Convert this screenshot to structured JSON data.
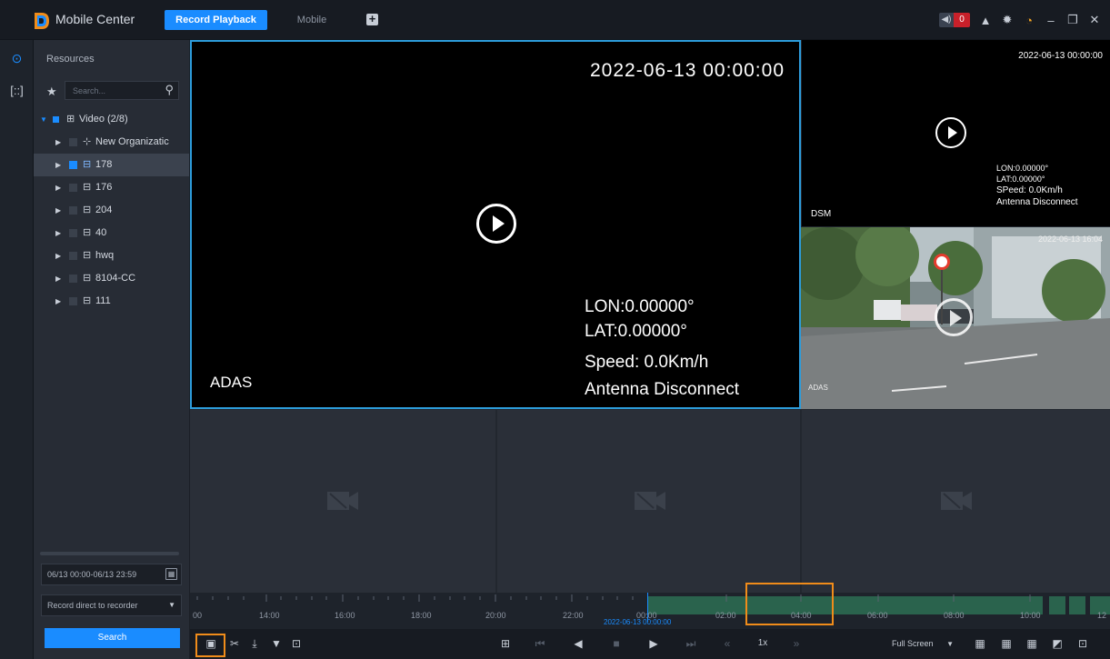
{
  "app": {
    "title": "Mobile Center"
  },
  "tabs": [
    {
      "label": "Record Playback",
      "active": true
    },
    {
      "label": "Mobile",
      "active": false
    }
  ],
  "alarm": {
    "count": "0"
  },
  "panel": {
    "title": "Resources",
    "search_placeholder": "Search...",
    "tree": [
      {
        "label": "Video (2/8)",
        "level": 0,
        "expanded": true,
        "check": "partial",
        "icon": "device-group-icon"
      },
      {
        "label": "New Organizatic",
        "level": 1,
        "check": "none",
        "icon": "organization-icon"
      },
      {
        "label": "178",
        "level": 1,
        "check": "checked",
        "icon": "vehicle-online-icon",
        "selected": true
      },
      {
        "label": "176",
        "level": 1,
        "check": "none",
        "icon": "vehicle-offline-icon"
      },
      {
        "label": "204",
        "level": 1,
        "check": "none",
        "icon": "vehicle-offline-icon"
      },
      {
        "label": "40",
        "level": 1,
        "check": "none",
        "icon": "vehicle-offline-icon"
      },
      {
        "label": "hwq",
        "level": 1,
        "check": "none",
        "icon": "vehicle-offline-icon"
      },
      {
        "label": "8104-CC",
        "level": 1,
        "check": "none",
        "icon": "vehicle-online-icon"
      },
      {
        "label": "111",
        "level": 1,
        "check": "none",
        "icon": "vehicle-offline-icon"
      }
    ],
    "date_range": "06/13 00:00-06/13 23:59",
    "record_mode": "Record direct to recorder",
    "search_button": "Search"
  },
  "video": {
    "main": {
      "timestamp": "2022-06-13 00:00:00",
      "channel": "ADAS",
      "lon": "LON:0.00000°",
      "lat": "LAT:0.00000°",
      "speed": "Speed: 0.0Km/h",
      "antenna": "Antenna Disconnect"
    },
    "right_top": {
      "timestamp": "2022-06-13 00:00:00",
      "channel": "DSM",
      "lon": "LON:0.00000°",
      "lat": "LAT:0.00000°",
      "speed": "SPeed: 0.0Km/h",
      "antenna": "Antenna Disconnect"
    },
    "right_mid": {
      "timestamp": "2022-06-13 16:04",
      "channel": "ADAS"
    }
  },
  "timeline": {
    "ticks": [
      "00",
      "14:00",
      "16:00",
      "18:00",
      "20:00",
      "22:00",
      "00:00",
      "02:00",
      "04:00",
      "06:00",
      "08:00",
      "10:00",
      "12"
    ],
    "current": "2022-06-13 00:00:00"
  },
  "toolbar": {
    "speed": "1x",
    "fullscreen": "Full Screen"
  }
}
